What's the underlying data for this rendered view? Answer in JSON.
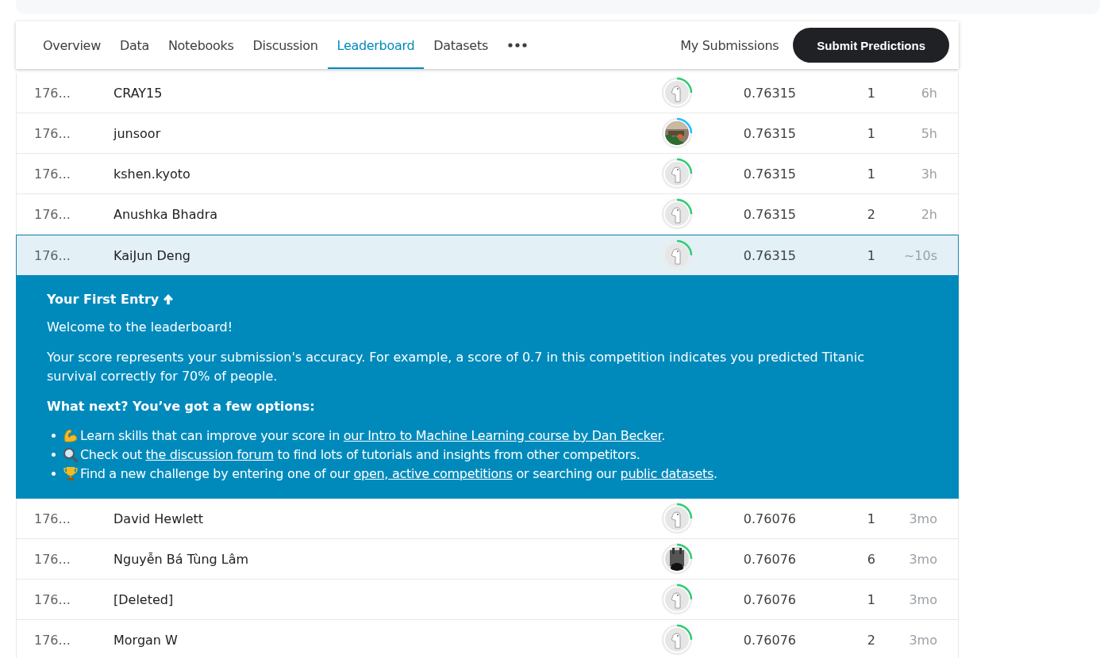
{
  "tabs": [
    {
      "label": "Overview",
      "selected": false
    },
    {
      "label": "Data",
      "selected": false
    },
    {
      "label": "Notebooks",
      "selected": false
    },
    {
      "label": "Discussion",
      "selected": false
    },
    {
      "label": "Leaderboard",
      "selected": true
    },
    {
      "label": "Datasets",
      "selected": false
    }
  ],
  "my_submissions": "My Submissions",
  "submit_button": "Submit Predictions",
  "rows_before": [
    {
      "rank": "176...",
      "name": "CRAY15",
      "kind": "default",
      "color": "#2ecc71",
      "score": "0.76315",
      "entries": "1",
      "last": "6h",
      "selected": false
    },
    {
      "rank": "176...",
      "name": "junsoor",
      "color": "#20beff",
      "score": "0.76315",
      "entries": "1",
      "last": "5h",
      "selected": false
    },
    {
      "rank": "176...",
      "name": "kshen.kyoto",
      "kind": "default",
      "color": "#2ecc71",
      "score": "0.76315",
      "entries": "1",
      "last": "3h",
      "selected": false
    },
    {
      "rank": "176...",
      "name": "Anushka Bhadra",
      "kind": "default",
      "color": "#2ecc71",
      "score": "0.76315",
      "entries": "2",
      "last": "2h",
      "selected": false
    },
    {
      "rank": "176...",
      "name": "KaiJun Deng",
      "kind": "default",
      "color": "#2ecc71",
      "score": "0.76315",
      "entries": "1",
      "last": "~10s",
      "selected": true
    }
  ],
  "entry_panel": {
    "title": "Your First Entry",
    "welcome": "Welcome to the leaderboard!",
    "description": "Your score represents your submission's accuracy. For example, a score of 0.7 in this competition indicates you predicted Titanic survival correctly for 70% of people.",
    "options_heading": "What next? You’ve got a few options:",
    "options": [
      {
        "kind": "arm",
        "parts": [
          {
            "text": "Learn skills that can improve your score in ",
            "link": false
          },
          {
            "text": "our Intro to Machine Learning course by Dan Becker",
            "link": true
          },
          {
            "text": ".",
            "link": false
          }
        ]
      },
      {
        "kind": "magnifier",
        "parts": [
          {
            "text": "Check out ",
            "link": false
          },
          {
            "text": "the discussion forum",
            "link": true
          },
          {
            "text": " to find lots of tutorials and insights from other competitors.",
            "link": false
          }
        ]
      },
      {
        "kind": "trophy",
        "parts": [
          {
            "text": "Find a new challenge by entering one of our ",
            "link": false
          },
          {
            "text": "open, active competitions",
            "link": true
          },
          {
            "text": " or searching our ",
            "link": false
          },
          {
            "text": "public datasets",
            "link": true
          },
          {
            "text": ".",
            "link": false
          }
        ]
      }
    ]
  },
  "rows_after": [
    {
      "rank": "176...",
      "name": "David Hewlett",
      "kind": "default",
      "color": "#2ecc71",
      "score": "0.76076",
      "entries": "1",
      "last": "3mo",
      "selected": false
    },
    {
      "rank": "176...",
      "name": "Nguyễn Bá Tùng Lâm",
      "color": "#2ecc71",
      "score": "0.76076",
      "entries": "6",
      "last": "3mo",
      "selected": false
    },
    {
      "rank": "176...",
      "name": "[Deleted]",
      "kind": "default",
      "color": "#2ecc71",
      "score": "0.76076",
      "entries": "1",
      "last": "3mo",
      "selected": false
    },
    {
      "rank": "176...",
      "name": "Morgan W",
      "kind": "default",
      "color": "#2ecc71",
      "score": "0.76076",
      "entries": "2",
      "last": "3mo",
      "selected": false
    }
  ]
}
